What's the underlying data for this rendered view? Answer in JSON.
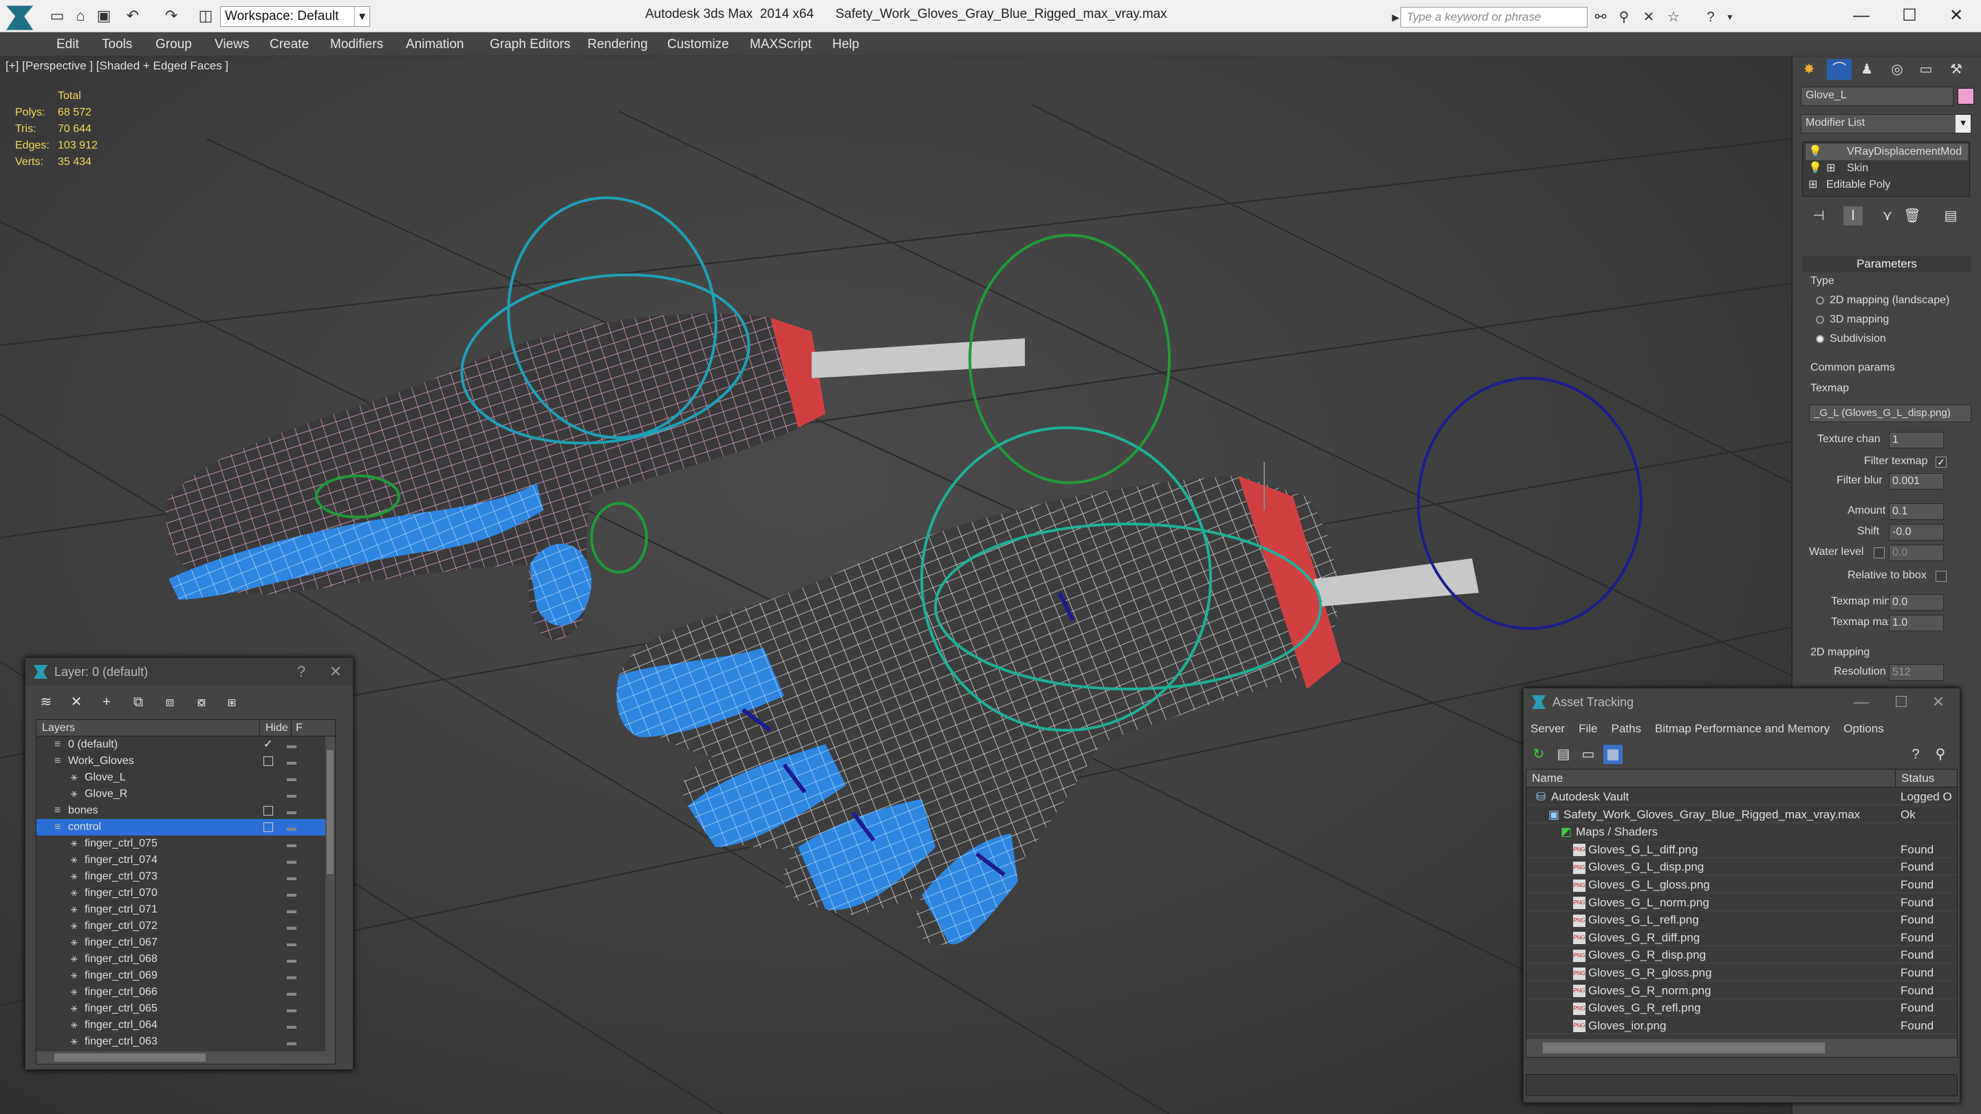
{
  "titlebar": {
    "app": "Autodesk 3ds Max  2014 x64",
    "file": "Safety_Work_Gloves_Gray_Blue_Rigged_max_vray.max",
    "workspace": "Workspace: Default",
    "search_placeholder": "Type a keyword or phrase"
  },
  "menu": [
    "Edit",
    "Tools",
    "Group",
    "Views",
    "Create",
    "Modifiers",
    "Animation",
    "Graph Editors",
    "Rendering",
    "Customize",
    "MAXScript",
    "Help"
  ],
  "viewport": {
    "label": "[+] [Perspective ] [Shaded + Edged Faces ]",
    "stats": {
      "header": "Total",
      "rows": [
        {
          "label": "Polys:",
          "value": "68 572"
        },
        {
          "label": "Tris:",
          "value": "70 644"
        },
        {
          "label": "Edges:",
          "value": "103 912"
        },
        {
          "label": "Verts:",
          "value": "35 434"
        }
      ]
    }
  },
  "command_panel": {
    "object_name": "Glove_L",
    "modifier_list": "Modifier List",
    "stack": [
      "VRayDisplacementMod",
      "Skin",
      "Editable Poly"
    ],
    "rollout_title": "Parameters",
    "type_label": "Type",
    "type_options": [
      "2D mapping (landscape)",
      "3D mapping",
      "Subdivision"
    ],
    "common_label": "Common params",
    "texmap_label": "Texmap",
    "texmap_value": "_G_L (Gloves_G_L_disp.png)",
    "texture_chan_label": "Texture chan",
    "texture_chan_value": "1",
    "filter_texmap_label": "Filter texmap",
    "filter_blur_label": "Filter blur",
    "filter_blur_value": "0.001",
    "amount_label": "Amount",
    "amount_value": "0.1",
    "shift_label": "Shift",
    "shift_value": "-0.0",
    "water_label": "Water level",
    "water_value": "0.0",
    "relative_label": "Relative to bbox",
    "texmap_min_label": "Texmap min",
    "texmap_min_value": "0.0",
    "texmap_max_label": "Texmap max",
    "texmap_max_value": "1.0",
    "mapping2d_label": "2D mapping",
    "resolution_label": "Resolution",
    "resolution_value": "512"
  },
  "layer_dialog": {
    "title": "Layer: 0 (default)",
    "col_layers": "Layers",
    "col_hide": "Hide",
    "col_f": "F",
    "rows": [
      {
        "label": "0 (default)",
        "indent": 1,
        "mark": "check"
      },
      {
        "label": "Work_Gloves",
        "indent": 1,
        "mark": "box"
      },
      {
        "label": "Glove_L",
        "indent": 2,
        "mark": ""
      },
      {
        "label": "Glove_R",
        "indent": 2,
        "mark": ""
      },
      {
        "label": "bones",
        "indent": 1,
        "mark": "box"
      },
      {
        "label": "control",
        "indent": 1,
        "mark": "box",
        "selected": true
      },
      {
        "label": "finger_ctrl_075",
        "indent": 2,
        "mark": ""
      },
      {
        "label": "finger_ctrl_074",
        "indent": 2,
        "mark": ""
      },
      {
        "label": "finger_ctrl_073",
        "indent": 2,
        "mark": ""
      },
      {
        "label": "finger_ctrl_070",
        "indent": 2,
        "mark": ""
      },
      {
        "label": "finger_ctrl_071",
        "indent": 2,
        "mark": ""
      },
      {
        "label": "finger_ctrl_072",
        "indent": 2,
        "mark": ""
      },
      {
        "label": "finger_ctrl_067",
        "indent": 2,
        "mark": ""
      },
      {
        "label": "finger_ctrl_068",
        "indent": 2,
        "mark": ""
      },
      {
        "label": "finger_ctrl_069",
        "indent": 2,
        "mark": ""
      },
      {
        "label": "finger_ctrl_066",
        "indent": 2,
        "mark": ""
      },
      {
        "label": "finger_ctrl_065",
        "indent": 2,
        "mark": ""
      },
      {
        "label": "finger_ctrl_064",
        "indent": 2,
        "mark": ""
      },
      {
        "label": "finger_ctrl_063",
        "indent": 2,
        "mark": ""
      }
    ]
  },
  "asset_dialog": {
    "title": "Asset Tracking",
    "menu": [
      "Server",
      "File",
      "Paths",
      "Bitmap Performance and Memory",
      "Options"
    ],
    "col_name": "Name",
    "col_status": "Status",
    "rows": [
      {
        "name": "Autodesk Vault",
        "status": "Logged O",
        "indent": 0,
        "icon": "vault"
      },
      {
        "name": "Safety_Work_Gloves_Gray_Blue_Rigged_max_vray.max",
        "status": "Ok",
        "indent": 1,
        "icon": "max"
      },
      {
        "name": "Maps / Shaders",
        "status": "",
        "indent": 2,
        "icon": "maps"
      },
      {
        "name": "Gloves_G_L_diff.png",
        "status": "Found",
        "indent": 3,
        "icon": "png"
      },
      {
        "name": "Gloves_G_L_disp.png",
        "status": "Found",
        "indent": 3,
        "icon": "png"
      },
      {
        "name": "Gloves_G_L_gloss.png",
        "status": "Found",
        "indent": 3,
        "icon": "png"
      },
      {
        "name": "Gloves_G_L_norm.png",
        "status": "Found",
        "indent": 3,
        "icon": "png"
      },
      {
        "name": "Gloves_G_L_refl.png",
        "status": "Found",
        "indent": 3,
        "icon": "png"
      },
      {
        "name": "Gloves_G_R_diff.png",
        "status": "Found",
        "indent": 3,
        "icon": "png"
      },
      {
        "name": "Gloves_G_R_disp.png",
        "status": "Found",
        "indent": 3,
        "icon": "png"
      },
      {
        "name": "Gloves_G_R_gloss.png",
        "status": "Found",
        "indent": 3,
        "icon": "png"
      },
      {
        "name": "Gloves_G_R_norm.png",
        "status": "Found",
        "indent": 3,
        "icon": "png"
      },
      {
        "name": "Gloves_G_R_refl.png",
        "status": "Found",
        "indent": 3,
        "icon": "png"
      },
      {
        "name": "Gloves_ior.png",
        "status": "Found",
        "indent": 3,
        "icon": "png"
      }
    ]
  },
  "colors": {
    "stats": "#f2d95c",
    "selection": "#2b6fd6",
    "glove_blue": "#2f86e0",
    "ctrl_teal": "#1fa0b8",
    "ctrl_green": "#1f9a3a",
    "ctrl_navy": "#1c1c8f",
    "wire_pink": "#e8a8d8"
  }
}
